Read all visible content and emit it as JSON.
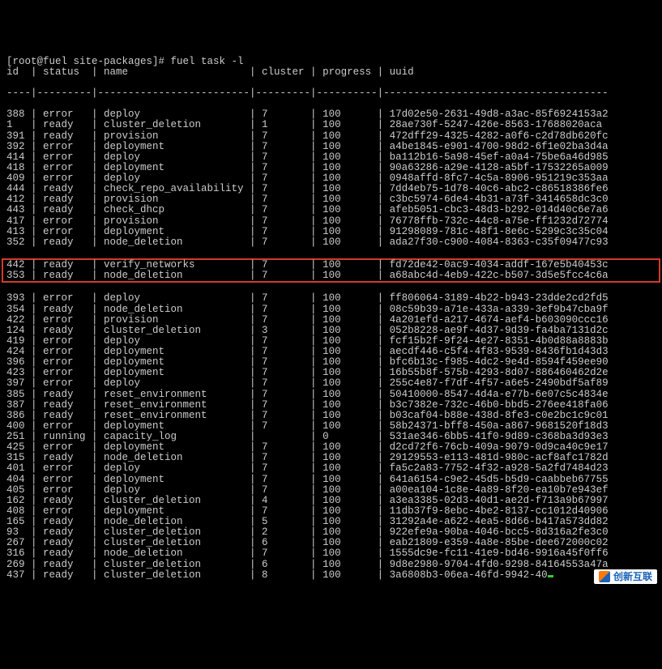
{
  "prompt": "[root@fuel site-packages]# fuel task -l",
  "header": {
    "id": "id",
    "status": "status",
    "name": "name",
    "cluster": "cluster",
    "progress": "progress",
    "uuid": "uuid"
  },
  "highlight_index": 14,
  "rows": [
    {
      "id": "388",
      "status": "error",
      "name": "deploy",
      "cluster": "7",
      "progress": "100",
      "uuid": "17d02e50-2631-49d8-a3ac-85f6924153a2"
    },
    {
      "id": "1",
      "status": "ready",
      "name": "cluster_deletion",
      "cluster": "1",
      "progress": "100",
      "uuid": "28ae730f-5247-426e-8563-17688020aca"
    },
    {
      "id": "391",
      "status": "ready",
      "name": "provision",
      "cluster": "7",
      "progress": "100",
      "uuid": "472dff29-4325-4282-a0f6-c2d78db620fc"
    },
    {
      "id": "392",
      "status": "error",
      "name": "deployment",
      "cluster": "7",
      "progress": "100",
      "uuid": "a4be1845-e901-4700-98d2-6f1e02ba3d4a"
    },
    {
      "id": "414",
      "status": "error",
      "name": "deploy",
      "cluster": "7",
      "progress": "100",
      "uuid": "ba112b16-5a98-45ef-a0a4-75be6a46d985"
    },
    {
      "id": "418",
      "status": "error",
      "name": "deployment",
      "cluster": "7",
      "progress": "100",
      "uuid": "90a63286-a29e-4128-a5bf-17532265a009"
    },
    {
      "id": "409",
      "status": "error",
      "name": "deploy",
      "cluster": "7",
      "progress": "100",
      "uuid": "0948affd-8fc7-4c5a-8906-951219c353aa"
    },
    {
      "id": "444",
      "status": "ready",
      "name": "check_repo_availability",
      "cluster": "7",
      "progress": "100",
      "uuid": "7dd4eb75-1d78-40c6-abc2-c86518386fe6"
    },
    {
      "id": "412",
      "status": "ready",
      "name": "provision",
      "cluster": "7",
      "progress": "100",
      "uuid": "c3bc5974-6de4-4b31-a73f-3414658dc3c0"
    },
    {
      "id": "443",
      "status": "ready",
      "name": "check_dhcp",
      "cluster": "7",
      "progress": "100",
      "uuid": "afeb5051-cbc3-48d3-b292-014d40c6e7a6"
    },
    {
      "id": "417",
      "status": "error",
      "name": "provision",
      "cluster": "7",
      "progress": "100",
      "uuid": "76778ffb-732c-44c8-a75e-ff1232d72774"
    },
    {
      "id": "413",
      "status": "error",
      "name": "deployment",
      "cluster": "7",
      "progress": "100",
      "uuid": "91298089-781c-48f1-8e6c-5299c3c35c04"
    },
    {
      "id": "352",
      "status": "ready",
      "name": "node_deletion",
      "cluster": "7",
      "progress": "100",
      "uuid": "ada27f30-c900-4084-8363-c35f09477c93"
    },
    {
      "id": "442",
      "status": "ready",
      "name": "verify_networks",
      "cluster": "7",
      "progress": "100",
      "uuid": "fd72de42-0ac9-4034-addf-167e5b40453c"
    },
    {
      "id": "353",
      "status": "ready",
      "name": "node_deletion",
      "cluster": "7",
      "progress": "100",
      "uuid": "a68abc4d-4eb9-422c-b507-3d5e5fcc4c6a"
    },
    {
      "id": "393",
      "status": "error",
      "name": "deploy",
      "cluster": "7",
      "progress": "100",
      "uuid": "ff806064-3189-4b22-b943-23dde2cd2fd5"
    },
    {
      "id": "354",
      "status": "ready",
      "name": "node_deletion",
      "cluster": "7",
      "progress": "100",
      "uuid": "08c59b39-a71e-433a-a339-3ef9b47cba9f"
    },
    {
      "id": "422",
      "status": "error",
      "name": "provision",
      "cluster": "7",
      "progress": "100",
      "uuid": "4a201efd-a217-4674-aef4-b603090ccc16"
    },
    {
      "id": "124",
      "status": "ready",
      "name": "cluster_deletion",
      "cluster": "3",
      "progress": "100",
      "uuid": "052b8228-ae9f-4d37-9d39-fa4ba7131d2c"
    },
    {
      "id": "419",
      "status": "error",
      "name": "deploy",
      "cluster": "7",
      "progress": "100",
      "uuid": "fcf15b2f-9f24-4e27-8351-4b0d88a8883b"
    },
    {
      "id": "424",
      "status": "error",
      "name": "deployment",
      "cluster": "7",
      "progress": "100",
      "uuid": "aecdf446-c5f4-4f83-9539-8436fb1d43d3"
    },
    {
      "id": "396",
      "status": "error",
      "name": "deployment",
      "cluster": "7",
      "progress": "100",
      "uuid": "bfc6b13c-f985-4dc2-9e4d-8594f459ee90"
    },
    {
      "id": "423",
      "status": "error",
      "name": "deployment",
      "cluster": "7",
      "progress": "100",
      "uuid": "16b55b8f-575b-4293-8d07-886460462d2e"
    },
    {
      "id": "397",
      "status": "error",
      "name": "deploy",
      "cluster": "7",
      "progress": "100",
      "uuid": "255c4e87-f7df-4f57-a6e5-2490bdf5af89"
    },
    {
      "id": "385",
      "status": "ready",
      "name": "reset_environment",
      "cluster": "7",
      "progress": "100",
      "uuid": "50410000-8547-4d4a-e77b-6e07c5c4834e"
    },
    {
      "id": "387",
      "status": "ready",
      "name": "reset_environment",
      "cluster": "7",
      "progress": "100",
      "uuid": "b3c7382e-732c-46b0-bbd5-276ee418fa06"
    },
    {
      "id": "386",
      "status": "ready",
      "name": "reset_environment",
      "cluster": "7",
      "progress": "100",
      "uuid": "b03caf04-b88e-438d-8fe3-c0e2bc1c9c01"
    },
    {
      "id": "400",
      "status": "error",
      "name": "deployment",
      "cluster": "7",
      "progress": "100",
      "uuid": "58b24371-bff8-450a-a867-9681520f18d3"
    },
    {
      "id": "251",
      "status": "running",
      "name": "capacity_log",
      "cluster": "",
      "progress": "0",
      "uuid": "531ae346-6bb5-41f0-9d89-c368ba3d93e3"
    },
    {
      "id": "425",
      "status": "error",
      "name": "deployment",
      "cluster": "7",
      "progress": "100",
      "uuid": "d2cd72f6-76cb-409a-9079-0d9ca40c9e17"
    },
    {
      "id": "315",
      "status": "ready",
      "name": "node_deletion",
      "cluster": "7",
      "progress": "100",
      "uuid": "29129553-e113-481d-980c-acf8afc1782d"
    },
    {
      "id": "401",
      "status": "error",
      "name": "deploy",
      "cluster": "7",
      "progress": "100",
      "uuid": "fa5c2a83-7752-4f32-a928-5a2fd7484d23"
    },
    {
      "id": "404",
      "status": "error",
      "name": "deployment",
      "cluster": "7",
      "progress": "100",
      "uuid": "641a6154-c9e2-45d5-b5d9-caabbeb67755"
    },
    {
      "id": "405",
      "status": "error",
      "name": "deploy",
      "cluster": "7",
      "progress": "100",
      "uuid": "a00ea104-1c8e-4a89-8f20-ea10b7e943ef"
    },
    {
      "id": "162",
      "status": "ready",
      "name": "cluster_deletion",
      "cluster": "4",
      "progress": "100",
      "uuid": "a3ea3385-02d3-40d1-ae2d-f713a9b67997"
    },
    {
      "id": "408",
      "status": "error",
      "name": "deployment",
      "cluster": "7",
      "progress": "100",
      "uuid": "11db37f9-8ebc-4be2-8137-cc1012d40906"
    },
    {
      "id": "165",
      "status": "ready",
      "name": "node_deletion",
      "cluster": "5",
      "progress": "100",
      "uuid": "31292a4e-a622-4ea5-8d66-b417a573dd82"
    },
    {
      "id": "93",
      "status": "ready",
      "name": "cluster_deletion",
      "cluster": "2",
      "progress": "100",
      "uuid": "922efe9a-90ba-4046-bcc5-8d316a2fe3c0"
    },
    {
      "id": "267",
      "status": "ready",
      "name": "cluster_deletion",
      "cluster": "6",
      "progress": "100",
      "uuid": "eab21809-e359-4a8e-85be-dee672000c02"
    },
    {
      "id": "316",
      "status": "ready",
      "name": "node_deletion",
      "cluster": "7",
      "progress": "100",
      "uuid": "1555dc9e-fc11-41e9-bd46-9916a45f0ff6"
    },
    {
      "id": "269",
      "status": "ready",
      "name": "cluster_deletion",
      "cluster": "6",
      "progress": "100",
      "uuid": "9d8e2980-9704-4fd0-9298-84164553a47a"
    },
    {
      "id": "437",
      "status": "ready",
      "name": "cluster_deletion",
      "cluster": "8",
      "progress": "100",
      "uuid": "3a6808b3-06ea-46fd-9942-40"
    }
  ],
  "watermark": "创新互联"
}
